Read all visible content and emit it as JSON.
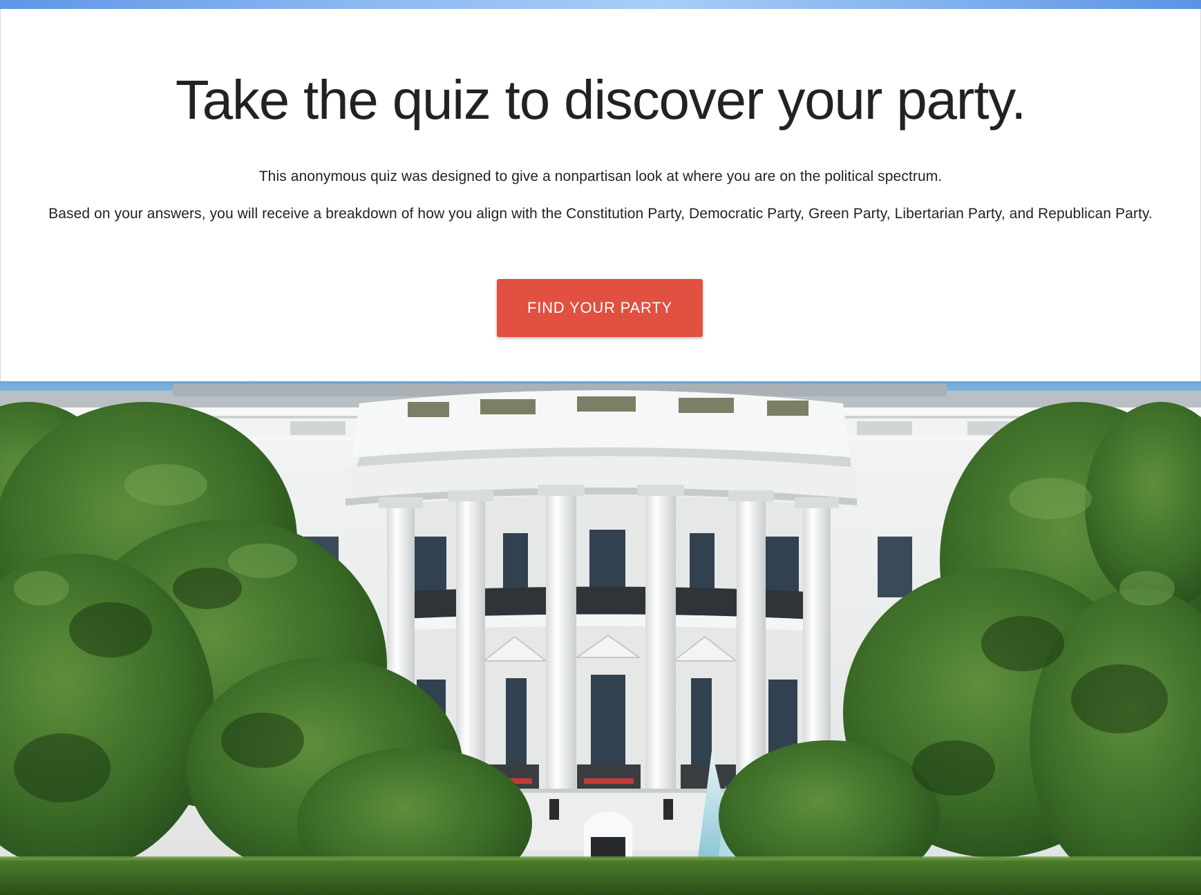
{
  "hero": {
    "title": "Take the quiz to discover your party.",
    "description_1": "This anonymous quiz was designed to give a nonpartisan look at where you are on the political spectrum.",
    "description_2": "Based on your answers, you will receive a breakdown of how you align with the Constitution Party, Democratic Party, Green Party, Libertarian Party, and Republican Party.",
    "cta_label": "FIND YOUR PARTY"
  },
  "colors": {
    "accent": "#e15040",
    "text": "#222222",
    "background": "#ffffff",
    "top_strip": "#8cb8f2"
  }
}
